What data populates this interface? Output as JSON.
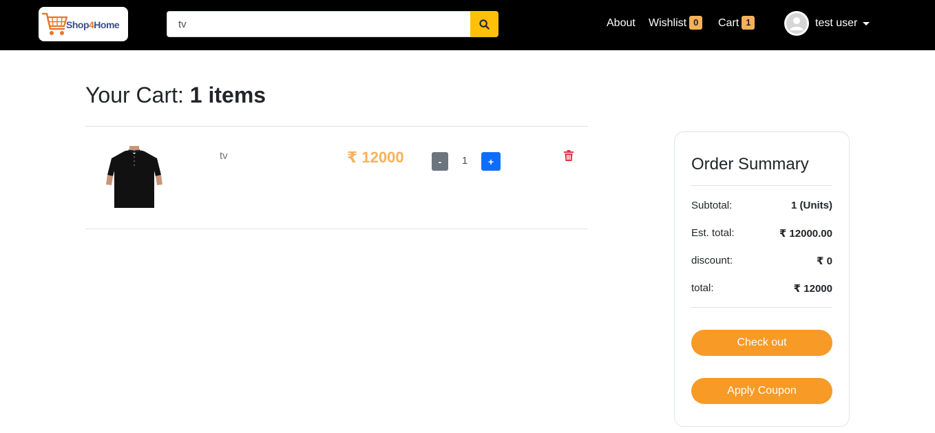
{
  "brand": {
    "name_part1": "Shop",
    "name_part2": "4",
    "name_part3": "Home",
    "logo_icon": "shopping-cart-icon"
  },
  "search": {
    "value": "tv",
    "placeholder": "Search",
    "button_icon": "search-icon"
  },
  "nav": {
    "about": "About",
    "wishlist": "Wishlist",
    "wishlist_count": "0",
    "cart": "Cart",
    "cart_count": "1",
    "user_name": "test user",
    "avatar_icon": "user-avatar-icon"
  },
  "cart": {
    "title_prefix": "Your Cart:",
    "title_count": "1 items",
    "items": [
      {
        "name": "tv",
        "price": "₹ 12000",
        "qty": "1",
        "minus_label": "-",
        "plus_label": "+",
        "image": "black-polo-shirt-image",
        "delete_icon": "trash-icon"
      }
    ]
  },
  "summary": {
    "title": "Order Summary",
    "rows": [
      {
        "label": "Subtotal:",
        "value": "1 (Units)"
      },
      {
        "label": "Est. total:",
        "value": "₹ 12000.00"
      },
      {
        "label": "discount:",
        "value": "₹ 0"
      },
      {
        "label": "total:",
        "value": "₹ 12000"
      }
    ],
    "checkout_label": "Check out",
    "coupon_label": "Apply Coupon"
  },
  "colors": {
    "navbar_bg": "#000000",
    "search_button": "#ffc107",
    "badge": "#f6b15b",
    "price": "#f6b15b",
    "primary_button": "#f79a26",
    "minus_button": "#6c757d",
    "plus_button": "#0d6efd",
    "delete": "#dc3545"
  }
}
